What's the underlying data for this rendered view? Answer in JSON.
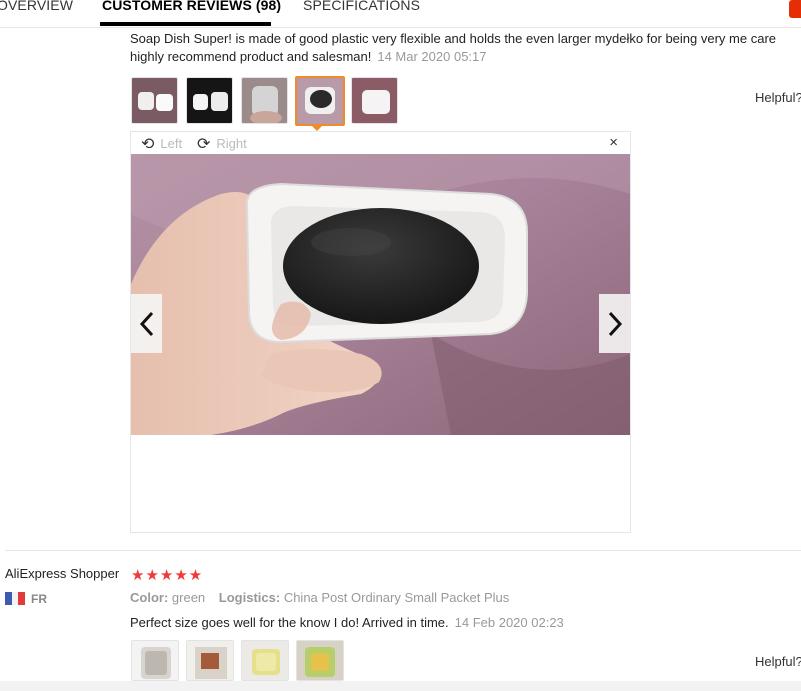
{
  "tabs": [
    {
      "label": "OVERVIEW"
    },
    {
      "label": "CUSTOMER REVIEWS (98)"
    },
    {
      "label": "SPECIFICATIONS"
    }
  ],
  "review1": {
    "text": "Soap Dish Super! is made of good plastic very flexible and holds the even larger mydełko for being very me care",
    "text_line2": "highly recommend product and salesman!",
    "date": "14 Mar 2020 05:17",
    "helpful": "Helpful?"
  },
  "viewer": {
    "rotate_left": "Left",
    "rotate_right": "Right",
    "close": "×"
  },
  "review2": {
    "reviewer": "AliExpress Shopper",
    "stars": "★★★★★",
    "rating": 5,
    "country": "FR",
    "color_label": "Color:",
    "color_value": "green",
    "logistics_label": "Logistics:",
    "logistics_value": "China Post Ordinary Small Packet Plus",
    "text": "Perfect size goes well for the know I do! Arrived in time.",
    "date": "14 Feb 2020 02:23",
    "helpful": "Helpful?"
  },
  "colors": {
    "accent": "#f08b2c",
    "star": "#f0393a",
    "brand_red": "#e62e04"
  }
}
